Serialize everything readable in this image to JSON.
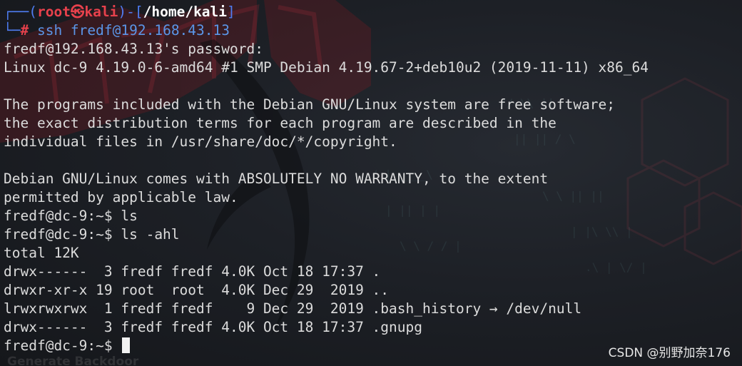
{
  "prompt": {
    "box_top": "┌──(",
    "user": "root㉿kali",
    "sep": ")-[",
    "path": "/home/kali",
    "close": "]",
    "box_bottom": "└─",
    "hash": "#",
    "command": " ssh fredf@192.168.43.13"
  },
  "output_lines": [
    "fredf@192.168.43.13's password:",
    "Linux dc-9 4.19.0-6-amd64 #1 SMP Debian 4.19.67-2+deb10u2 (2019-11-11) x86_64",
    "",
    "The programs included with the Debian GNU/Linux system are free software;",
    "the exact distribution terms for each program are described in the",
    "individual files in /usr/share/doc/*/copyright.",
    "",
    "Debian GNU/Linux comes with ABSOLUTELY NO WARRANTY, to the extent",
    "permitted by applicable law.",
    "fredf@dc-9:~$ ls",
    "fredf@dc-9:~$ ls -ahl",
    "total 12K",
    "drwx------  3 fredf fredf 4.0K Oct 18 17:37 .",
    "drwxr-xr-x 19 root  root  4.0K Dec 29  2019 ..",
    "lrwxrwxrwx  1 fredf fredf    9 Dec 29  2019 .bash_history → /dev/null",
    "drwx------  3 fredf fredf 4.0K Oct 18 17:37 .gnupg"
  ],
  "current_prompt": "fredf@dc-9:~$ ",
  "watermark": "CSDN @别野加奈176",
  "background_text": "Generate Backdoor",
  "colors": {
    "prompt_box": "#4f7df3",
    "prompt_user": "#e8414c",
    "text": "#dcdcdc"
  }
}
